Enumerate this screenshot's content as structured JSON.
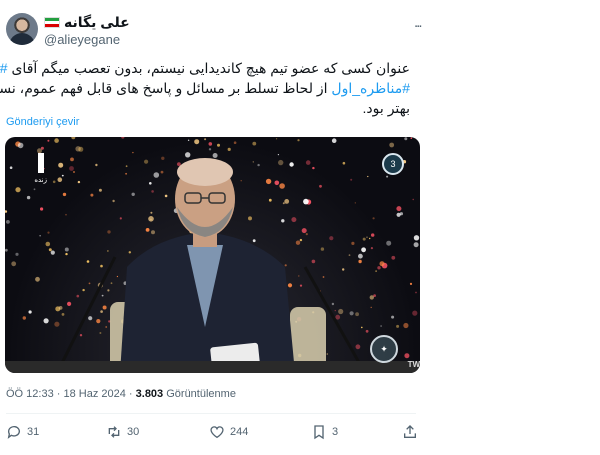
{
  "tweet": {
    "display_name": "علی یگانه",
    "handle": "@alieyegane",
    "more_menu": "...",
    "text_lines": [
      "عنوان کسی که عضو تیم هیچ کاندیدایی نیستم، بدون تعصب میگم آقای #قالیباف در",
      "#مناظره_اول از لحاظ تسلط بر مسائل و پاسخ های قابل فهم عموم، نسبت به بقیه",
      "بهتر بود."
    ],
    "hashtags": [
      "#قالیباف",
      "#مناظره_اول"
    ],
    "translate_link": "Gönderiyi çevir",
    "media": {
      "live_label": "زنده",
      "channel_logo": "3",
      "watermark": "TW"
    },
    "timestamp": "ÖÖ 12:33 · 18 Haz 2024 · ",
    "views_count": "3.803",
    "views_label": " Görüntülenme",
    "actions": {
      "replies": "31",
      "retweets": "30",
      "likes": "244",
      "bookmarks": "3"
    }
  },
  "colors": {
    "accent": "#1d9bf0",
    "text_secondary": "#536471",
    "text_primary": "#0f1419"
  },
  "icons": {
    "reply": "reply-icon",
    "retweet": "retweet-icon",
    "like": "heart-icon",
    "bookmark": "bookmark-icon",
    "share": "share-icon",
    "more": "more-icon"
  }
}
